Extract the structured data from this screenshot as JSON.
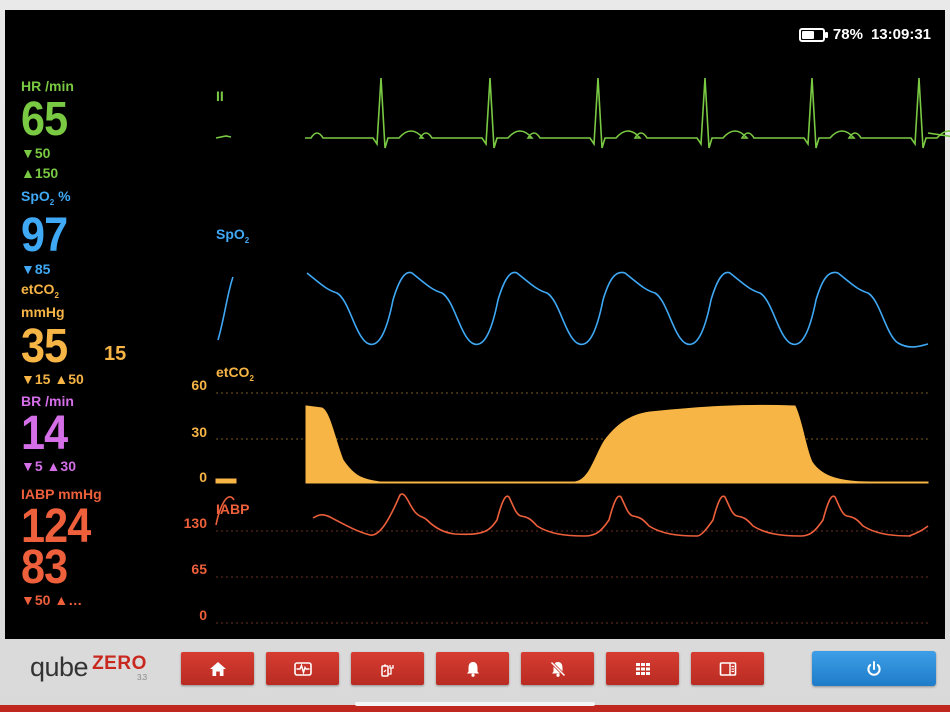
{
  "status": {
    "battery_percent": "78%",
    "battery_level": 0.78,
    "time": "13:09:31"
  },
  "params": {
    "hr": {
      "label": "HR /min",
      "value": "65",
      "low": "50",
      "high": "150"
    },
    "spo2": {
      "label_main": "SpO",
      "label_sub": "2",
      "label_unit": " %",
      "value": "97",
      "low": "85"
    },
    "etco2": {
      "label_main": "etCO",
      "label_sub": "2",
      "unit": "mmHg",
      "value": "35",
      "rate": "15",
      "low": "15",
      "high": "50"
    },
    "br": {
      "label": "BR /min",
      "value": "14",
      "low": "5",
      "high": "30"
    },
    "iabp": {
      "label": "IABP mmHg",
      "systolic": "124",
      "diastolic": "83",
      "low": "50",
      "high": "…"
    }
  },
  "waves": {
    "ecg": {
      "label": "II"
    },
    "spo2": {
      "label_main": "SpO",
      "label_sub": "2"
    },
    "etco2": {
      "label_main": "etCO",
      "label_sub": "2",
      "scale": [
        "60",
        "30",
        "0"
      ]
    },
    "iabp": {
      "label": "IABP",
      "scale": [
        "130",
        "65",
        "0"
      ]
    }
  },
  "colors": {
    "hr": "#7ac943",
    "spo2": "#3fa9f5",
    "etco2": "#f7b546",
    "br": "#d46fe8",
    "iabp": "#ee5f3b",
    "button": "#c9342a",
    "power": "#2b8ad6"
  },
  "brand": {
    "name": "qube",
    "suffix": "ZERO",
    "version": "3.3"
  },
  "toolbar": [
    {
      "icon": "home-icon"
    },
    {
      "icon": "waveform-icon"
    },
    {
      "icon": "battery-plug-icon"
    },
    {
      "icon": "bell-icon"
    },
    {
      "icon": "bell-off-icon"
    },
    {
      "icon": "grid-icon"
    },
    {
      "icon": "layout-icon"
    }
  ],
  "power": {
    "icon": "power-icon"
  }
}
